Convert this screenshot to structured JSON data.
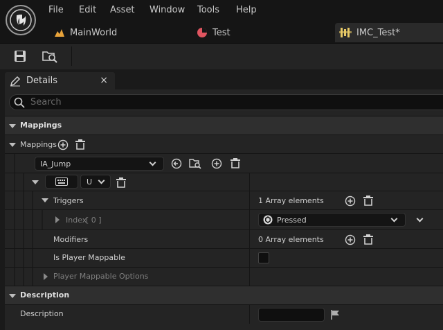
{
  "menu": [
    "File",
    "Edit",
    "Asset",
    "Window",
    "Tools",
    "Help"
  ],
  "tabs": [
    {
      "label": "MainWorld",
      "icon": "level-icon"
    },
    {
      "label": "Test",
      "icon": "pie-icon"
    },
    {
      "label": "IMC_Test*",
      "icon": "input-mapping-icon",
      "active": true
    }
  ],
  "toolbar": {
    "save_icon": "save-icon",
    "browse_icon": "browse-asset-icon"
  },
  "details_tab": {
    "label": "Details",
    "close": "×"
  },
  "search": {
    "placeholder": "Search"
  },
  "categories": {
    "mappings": "Mappings",
    "description": "Description"
  },
  "mappings": {
    "label": "Mappings",
    "action": "IA_Jump",
    "key_value": "U",
    "triggers": {
      "label": "Triggers",
      "count": "1 Array elements"
    },
    "index": {
      "label": "Index",
      "value": "[ 0 ]",
      "trigger_type": "Pressed"
    },
    "modifiers": {
      "label": "Modifiers",
      "count": "0 Array elements"
    },
    "is_player_mappable": {
      "label": "Is Player Mappable",
      "checked": false
    },
    "player_mappable_options": {
      "label": "Player Mappable Options"
    }
  },
  "description": {
    "label": "Description",
    "value": ""
  },
  "colors": {
    "accent_level": "#e8a33a",
    "accent_pie": "#e05560",
    "accent_imc": "#e6c866",
    "panel_bg": "#242424",
    "category_bg": "#2f2f2f"
  }
}
